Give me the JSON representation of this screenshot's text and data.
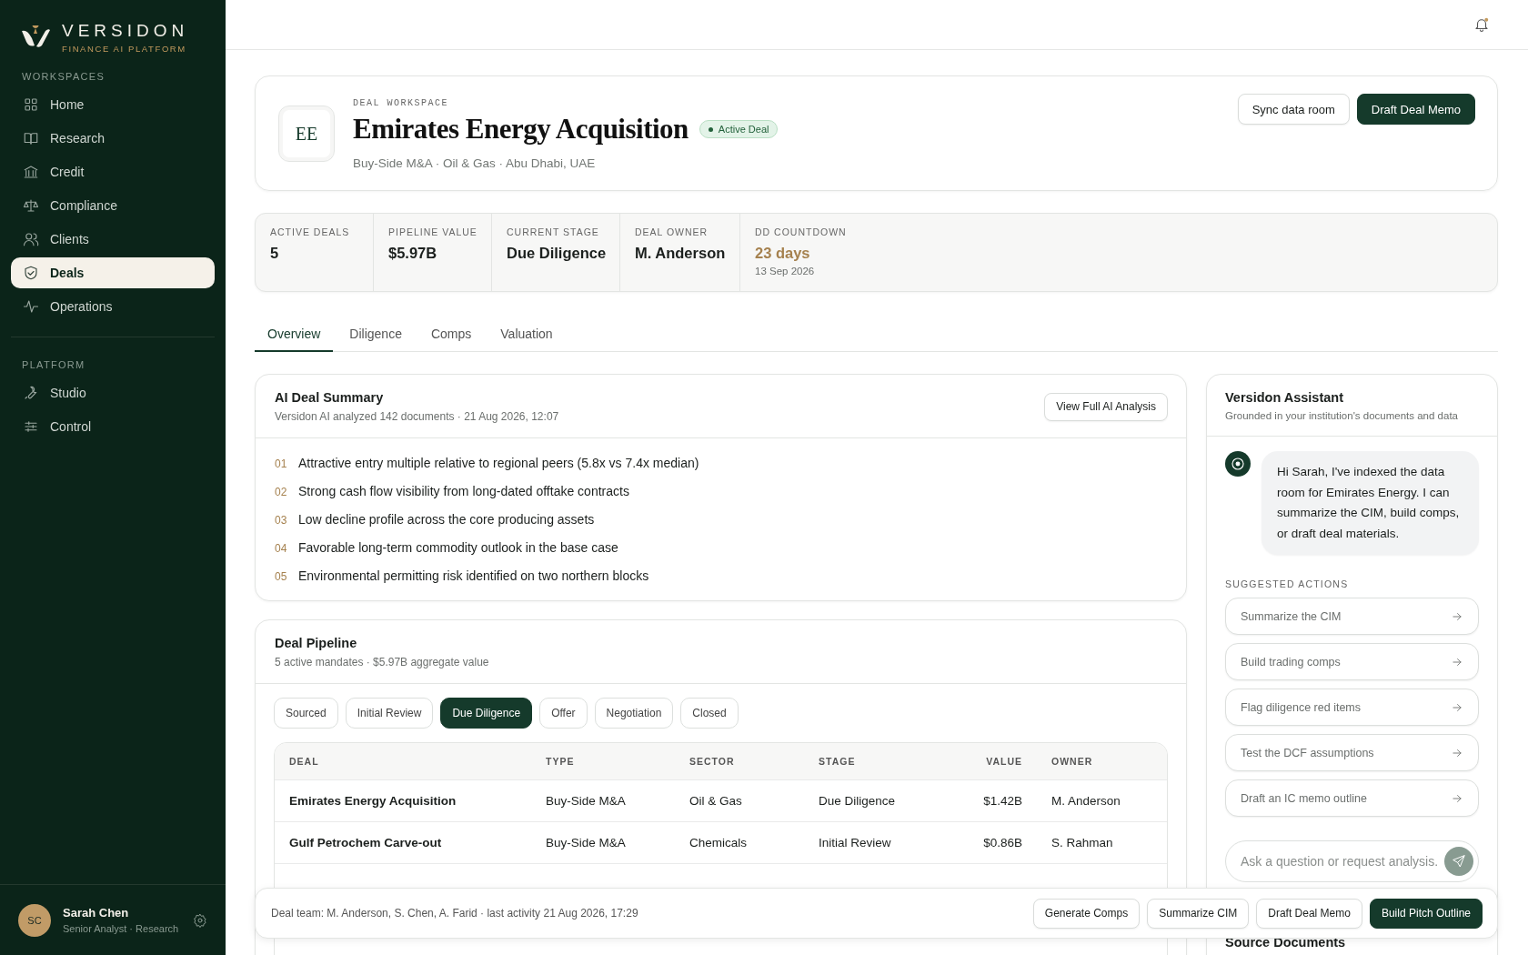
{
  "brand": {
    "name": "VERSIDON",
    "tagline": "FINANCE AI PLATFORM"
  },
  "sidebar": {
    "sections": [
      {
        "title": "WORKSPACES",
        "items": [
          {
            "label": "Home",
            "selected": false
          },
          {
            "label": "Research",
            "selected": false
          },
          {
            "label": "Credit",
            "selected": false
          },
          {
            "label": "Compliance",
            "selected": false
          },
          {
            "label": "Clients",
            "selected": false
          },
          {
            "label": "Deals",
            "selected": true
          },
          {
            "label": "Operations",
            "selected": false
          }
        ]
      },
      {
        "title": "PLATFORM",
        "items": [
          {
            "label": "Studio",
            "selected": false
          },
          {
            "label": "Control",
            "selected": false
          }
        ]
      }
    ]
  },
  "user": {
    "initials": "SC",
    "name": "Sarah Chen",
    "role": "Senior Analyst · Research"
  },
  "deal": {
    "avatar": "EE",
    "eyebrow": "DEAL WORKSPACE",
    "title": "Emirates Energy Acquisition",
    "status": "Active Deal",
    "meta": "Buy-Side M&A · Oil & Gas · Abu Dhabi, UAE",
    "buttons": [
      {
        "label": "Sync data room",
        "kind": "secondary"
      },
      {
        "label": "Draft Deal Memo",
        "kind": "primary"
      }
    ]
  },
  "kpis": [
    {
      "label": "ACTIVE DEALS",
      "value": "5",
      "kind": "plain"
    },
    {
      "label": "PIPELINE VALUE",
      "value": "$5.97B",
      "kind": "plain"
    },
    {
      "label": "CURRENT STAGE",
      "value": "Due Diligence",
      "kind": "plain"
    },
    {
      "label": "DEAL OWNER",
      "value": "M. Anderson",
      "kind": "plain"
    },
    {
      "label": "DD COUNTDOWN",
      "value": "23 days",
      "note": "13 Sep 2026",
      "kind": "highlight"
    }
  ],
  "tabs": [
    {
      "label": "Overview",
      "selected": true
    },
    {
      "label": "Diligence",
      "selected": false
    },
    {
      "label": "Comps",
      "selected": false
    },
    {
      "label": "Valuation",
      "selected": false
    }
  ],
  "summary": {
    "title": "AI Deal Summary",
    "subtitle": "Versidon AI analyzed 142 documents · 21 Aug 2026, 12:07",
    "button": "View Full AI Analysis",
    "points": [
      {
        "number": "01",
        "text": "Attractive entry multiple relative to regional peers (5.8x vs 7.4x median)"
      },
      {
        "number": "02",
        "text": "Strong cash flow visibility from long-dated offtake contracts"
      },
      {
        "number": "03",
        "text": "Low decline profile across the core producing assets"
      },
      {
        "number": "04",
        "text": "Favorable long-term commodity outlook in the base case"
      },
      {
        "number": "05",
        "text": "Environmental permitting risk identified on two northern blocks"
      }
    ]
  },
  "pipeline": {
    "title": "Deal Pipeline",
    "subtitle": "5 active mandates · $5.97B aggregate value",
    "stages": [
      {
        "label": "Sourced",
        "selected": false
      },
      {
        "label": "Initial Review",
        "selected": false
      },
      {
        "label": "Due Diligence",
        "selected": true
      },
      {
        "label": "Offer",
        "selected": false
      },
      {
        "label": "Negotiation",
        "selected": false
      },
      {
        "label": "Closed",
        "selected": false
      }
    ],
    "table": {
      "columns": [
        "DEAL",
        "TYPE",
        "SECTOR",
        "STAGE",
        "VALUE",
        "OWNER"
      ],
      "rows": [
        [
          "Emirates Energy Acquisition",
          "Buy-Side M&A",
          "Oil & Gas",
          "Due Diligence",
          "$1.42B",
          "M. Anderson"
        ],
        [
          "Gulf Petrochem Carve-out",
          "Buy-Side M&A",
          "Chemicals",
          "Initial Review",
          "$0.86B",
          "S. Rahman"
        ]
      ]
    }
  },
  "assistant": {
    "title": "Versidon Assistant",
    "subtitle": "Grounded in your institution's documents and data",
    "message": "Hi Sarah, I've indexed the data room for Emirates Energy. I can summarize the CIM, build comps, or draft deal materials.",
    "suggested_title": "SUGGESTED ACTIONS",
    "actions": [
      "Summarize the CIM",
      "Build trading comps",
      "Flag diligence red items",
      "Test the DCF assumptions",
      "Draft an IC memo outline"
    ],
    "input": {
      "placeholder": "Ask a question or request analysis."
    },
    "next_section": "Source Documents"
  },
  "action_bar": {
    "text": "Deal team: M. Anderson, S. Chen, A. Farid · last activity 21 Aug 2026, 17:29",
    "buttons": [
      {
        "label": "Generate Comps",
        "kind": "secondary"
      },
      {
        "label": "Summarize CIM",
        "kind": "secondary"
      },
      {
        "label": "Draft Deal Memo",
        "kind": "secondary"
      },
      {
        "label": "Build Pitch Outline",
        "kind": "primary"
      }
    ]
  }
}
